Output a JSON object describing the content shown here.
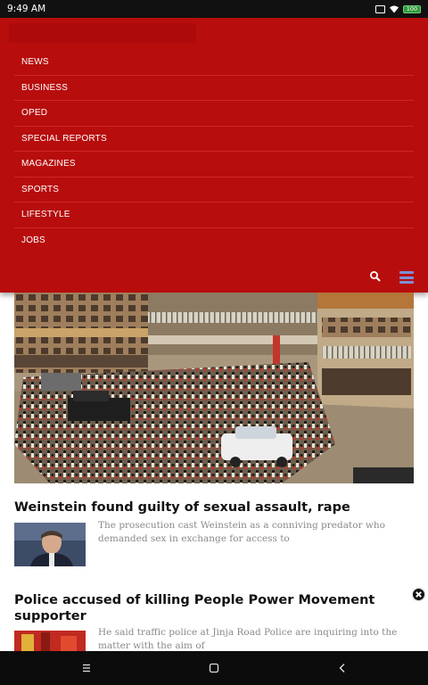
{
  "status_bar": {
    "time": "9:49 AM",
    "battery": "100",
    "icons": [
      "sim-icon",
      "wifi-icon",
      "battery-icon"
    ]
  },
  "nav": {
    "menu_items": [
      {
        "label": "NEWS"
      },
      {
        "label": "BUSINESS"
      },
      {
        "label": "OPED"
      },
      {
        "label": "SPECIAL REPORTS"
      },
      {
        "label": "MAGAZINES"
      },
      {
        "label": "SPORTS"
      },
      {
        "label": "LIFESTYLE"
      },
      {
        "label": "JOBS"
      }
    ],
    "icons": [
      "search-icon",
      "hamburger-menu-icon"
    ]
  },
  "articles": [
    {
      "headline": "Weinstein found guilty of sexual assault, rape",
      "excerpt": "The prosecution cast Weinstein as a conniving predator who demanded sex in exchange for access to"
    },
    {
      "headline": "Police accused of killing People Power Movement supporter",
      "excerpt": "He said traffic police at Jinja Road Police are inquiring into the matter with the aim of"
    }
  ],
  "colors": {
    "brand_red": "#b70d0d",
    "divider": "#d32424",
    "menu_icon": "#7d8fd6",
    "status_bar": "#111111",
    "excerpt_text": "#8a8a8a"
  },
  "android_nav": {
    "icons": [
      "recents-icon",
      "home-icon",
      "back-icon"
    ]
  }
}
